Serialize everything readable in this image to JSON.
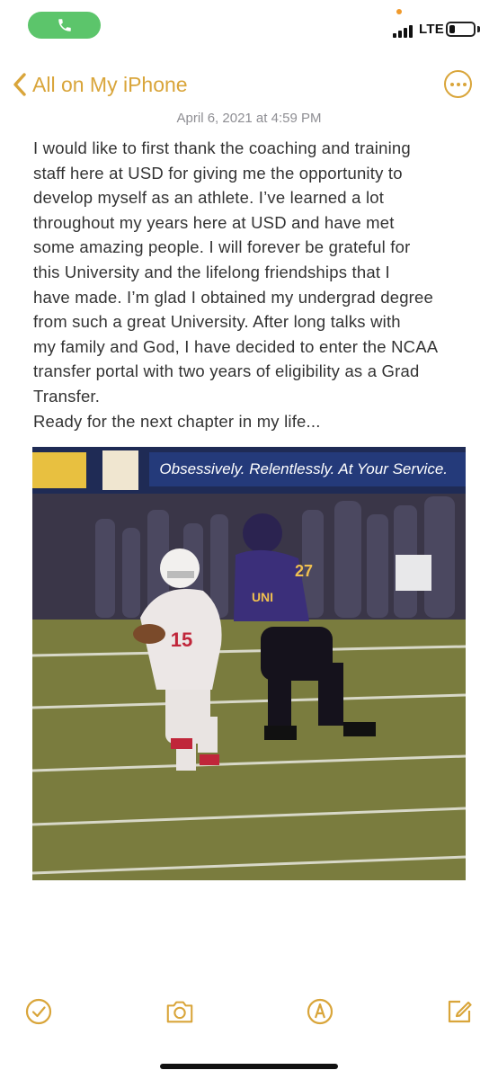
{
  "status_bar": {
    "network": "LTE",
    "battery_level": 0.25,
    "call_icon": "phone-icon",
    "accent": "#5cc56b"
  },
  "nav": {
    "back_label": "All on My iPhone",
    "more_icon": "ellipsis-circle-icon",
    "accent": "#d9a53a"
  },
  "note": {
    "date": "April 6, 2021 at 4:59 PM",
    "lines": [
      "I would like to first thank the coaching and training",
      "staff here at USD for giving me the opportunity to",
      "develop myself as an athlete. I’ve learned a lot",
      "throughout my years here at USD and have met",
      "some amazing people.  I will forever be grateful for",
      "this University and the lifelong friendships that I",
      "have made. I’m glad I obtained my undergrad degree",
      "from such a great University.  After long talks with",
      "my family and God, I have decided to enter the NCAA",
      "transfer portal with two years of eligibility as a Grad",
      "Transfer.",
      "Ready for the next chapter in my life..."
    ]
  },
  "photo": {
    "banner_text": "Obsessively. Relentlessly. At Your Service.",
    "left_jersey_number": "15",
    "right_jersey_number": "27",
    "right_jersey_text": "UNI"
  },
  "toolbar": {
    "items": [
      "checklist-icon",
      "camera-icon",
      "markup-icon",
      "compose-icon"
    ]
  }
}
